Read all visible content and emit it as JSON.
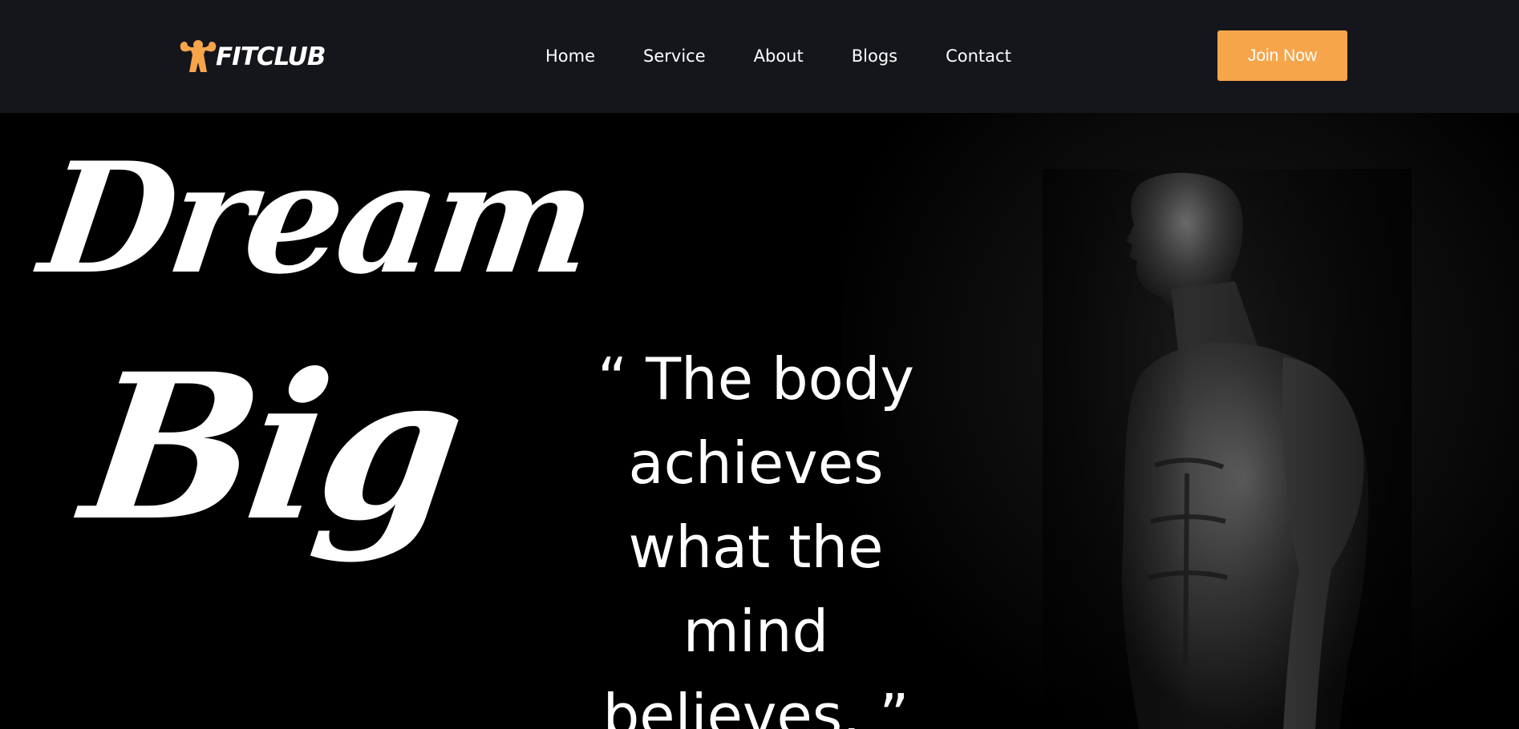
{
  "brand": {
    "name": "FITCLUB",
    "accent": "#f6a54b",
    "logo_icon": "flexing-strongman-icon"
  },
  "nav": {
    "items": [
      {
        "label": "Home"
      },
      {
        "label": "Service"
      },
      {
        "label": "About"
      },
      {
        "label": "Blogs"
      },
      {
        "label": "Contact"
      }
    ],
    "cta_label": "Join Now"
  },
  "hero": {
    "headline_line1": "Dream",
    "headline_line2": "Big",
    "quote": "“ The body achieves what the mind believes. ”",
    "image": "muscular-athlete-portrait"
  }
}
